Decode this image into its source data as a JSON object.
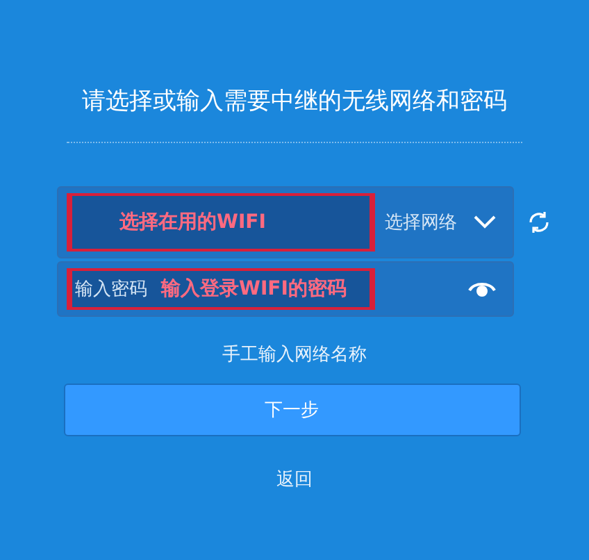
{
  "title": "请选择或输入需要中继的无线网络和密码",
  "network_select": {
    "placeholder": "选择网络",
    "annotation": "选择在用的WIFI"
  },
  "password_field": {
    "placeholder": "输入密码",
    "annotation": "输入登录WIFI的密码"
  },
  "manual_link": "手工输入网络名称",
  "next_button": "下一步",
  "back_link": "返回"
}
